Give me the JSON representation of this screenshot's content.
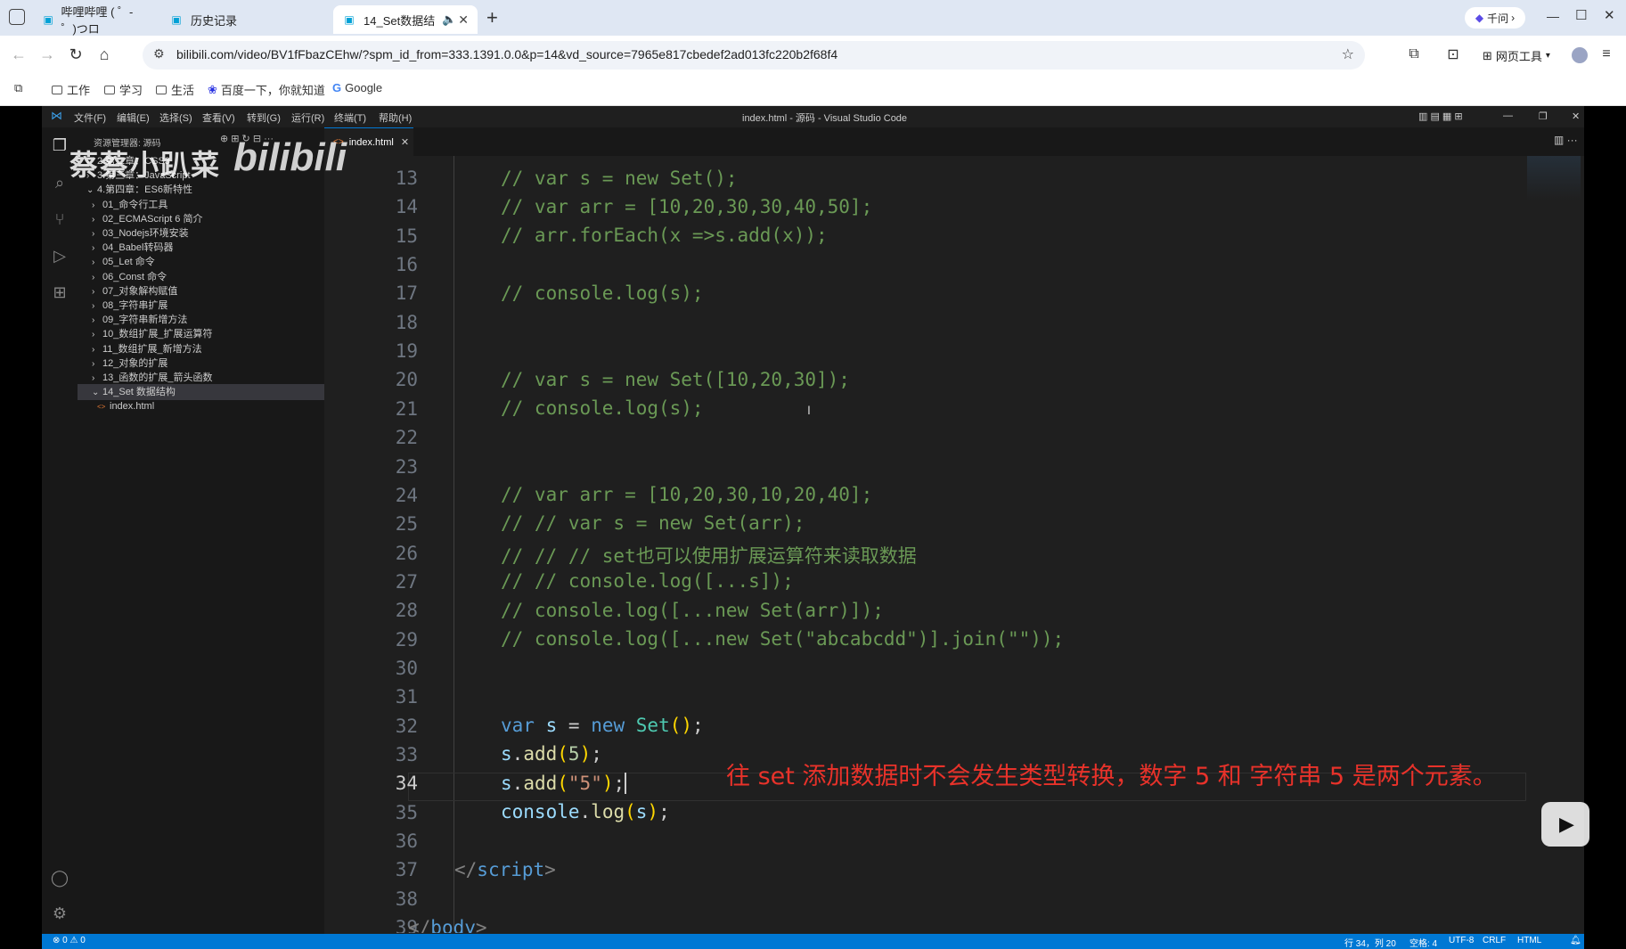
{
  "browser": {
    "tabs": [
      {
        "label": "哔哩哔哩 ( ゜- ゜)つロ"
      },
      {
        "label": "历史记录"
      },
      {
        "label": "14_Set数据结"
      }
    ],
    "new_tab": "+",
    "qianwen": "千问",
    "url": "bilibili.com/video/BV1fFbazCEhw/?spm_id_from=333.1391.0.0&p=14&vd_source=7965e817cbedef2ad013fc220b2f68f4",
    "tools_label": "网页工具",
    "bookmarks": [
      "工作",
      "学习",
      "生活",
      "百度一下，你就知道",
      "Google"
    ]
  },
  "vscode": {
    "menu": [
      "文件(F)",
      "编辑(E)",
      "选择(S)",
      "查看(V)",
      "转到(G)",
      "运行(R)",
      "终端(T)",
      "帮助(H)"
    ],
    "window_title": "index.html - 源码 - Visual Studio Code",
    "explorer_title": "资源管理器: 源码",
    "tree": [
      {
        "label": "2.第二章：CSS3",
        "depth": 1,
        "open": false
      },
      {
        "label": "3.第三章：JavaScript",
        "depth": 1,
        "open": false
      },
      {
        "label": "4.第四章：ES6新特性",
        "depth": 1,
        "open": true
      },
      {
        "label": "01_命令行工具",
        "depth": 2,
        "open": false
      },
      {
        "label": "02_ECMAScript 6 简介",
        "depth": 2,
        "open": false
      },
      {
        "label": "03_Nodejs环境安装",
        "depth": 2,
        "open": false
      },
      {
        "label": "04_Babel转码器",
        "depth": 2,
        "open": false
      },
      {
        "label": "05_Let 命令",
        "depth": 2,
        "open": false
      },
      {
        "label": "06_Const 命令",
        "depth": 2,
        "open": false
      },
      {
        "label": "07_对象解构赋值",
        "depth": 2,
        "open": false
      },
      {
        "label": "08_字符串扩展",
        "depth": 2,
        "open": false
      },
      {
        "label": "09_字符串新增方法",
        "depth": 2,
        "open": false
      },
      {
        "label": "10_数组扩展_扩展运算符",
        "depth": 2,
        "open": false
      },
      {
        "label": "11_数组扩展_新增方法",
        "depth": 2,
        "open": false
      },
      {
        "label": "12_对象的扩展",
        "depth": 2,
        "open": false
      },
      {
        "label": "13_函数的扩展_箭头函数",
        "depth": 2,
        "open": false
      },
      {
        "label": "14_Set 数据结构",
        "depth": 2,
        "open": true
      },
      {
        "label": "index.html",
        "depth": 3,
        "file": true
      }
    ],
    "editor_tab": "index.html",
    "line_numbers": [
      "13",
      "14",
      "15",
      "16",
      "17",
      "18",
      "19",
      "20",
      "21",
      "22",
      "23",
      "24",
      "25",
      "26",
      "27",
      "28",
      "29",
      "30",
      "31",
      "32",
      "33",
      "34",
      "35",
      "36",
      "37",
      "38",
      "39"
    ],
    "current_line": "34",
    "annotation": "往 set 添加数据时不会发生类型转换，数字 5 和 字符串 5 是两个元素。",
    "status": {
      "errors": "⊗ 0 ⚠ 0",
      "position": "行 34，列 20",
      "spaces": "空格: 4",
      "encoding": "UTF-8",
      "eol": "CRLF",
      "language": "HTML"
    }
  },
  "watermark": {
    "text": "蔡蔡小趴菜",
    "logo": "bilibili"
  }
}
